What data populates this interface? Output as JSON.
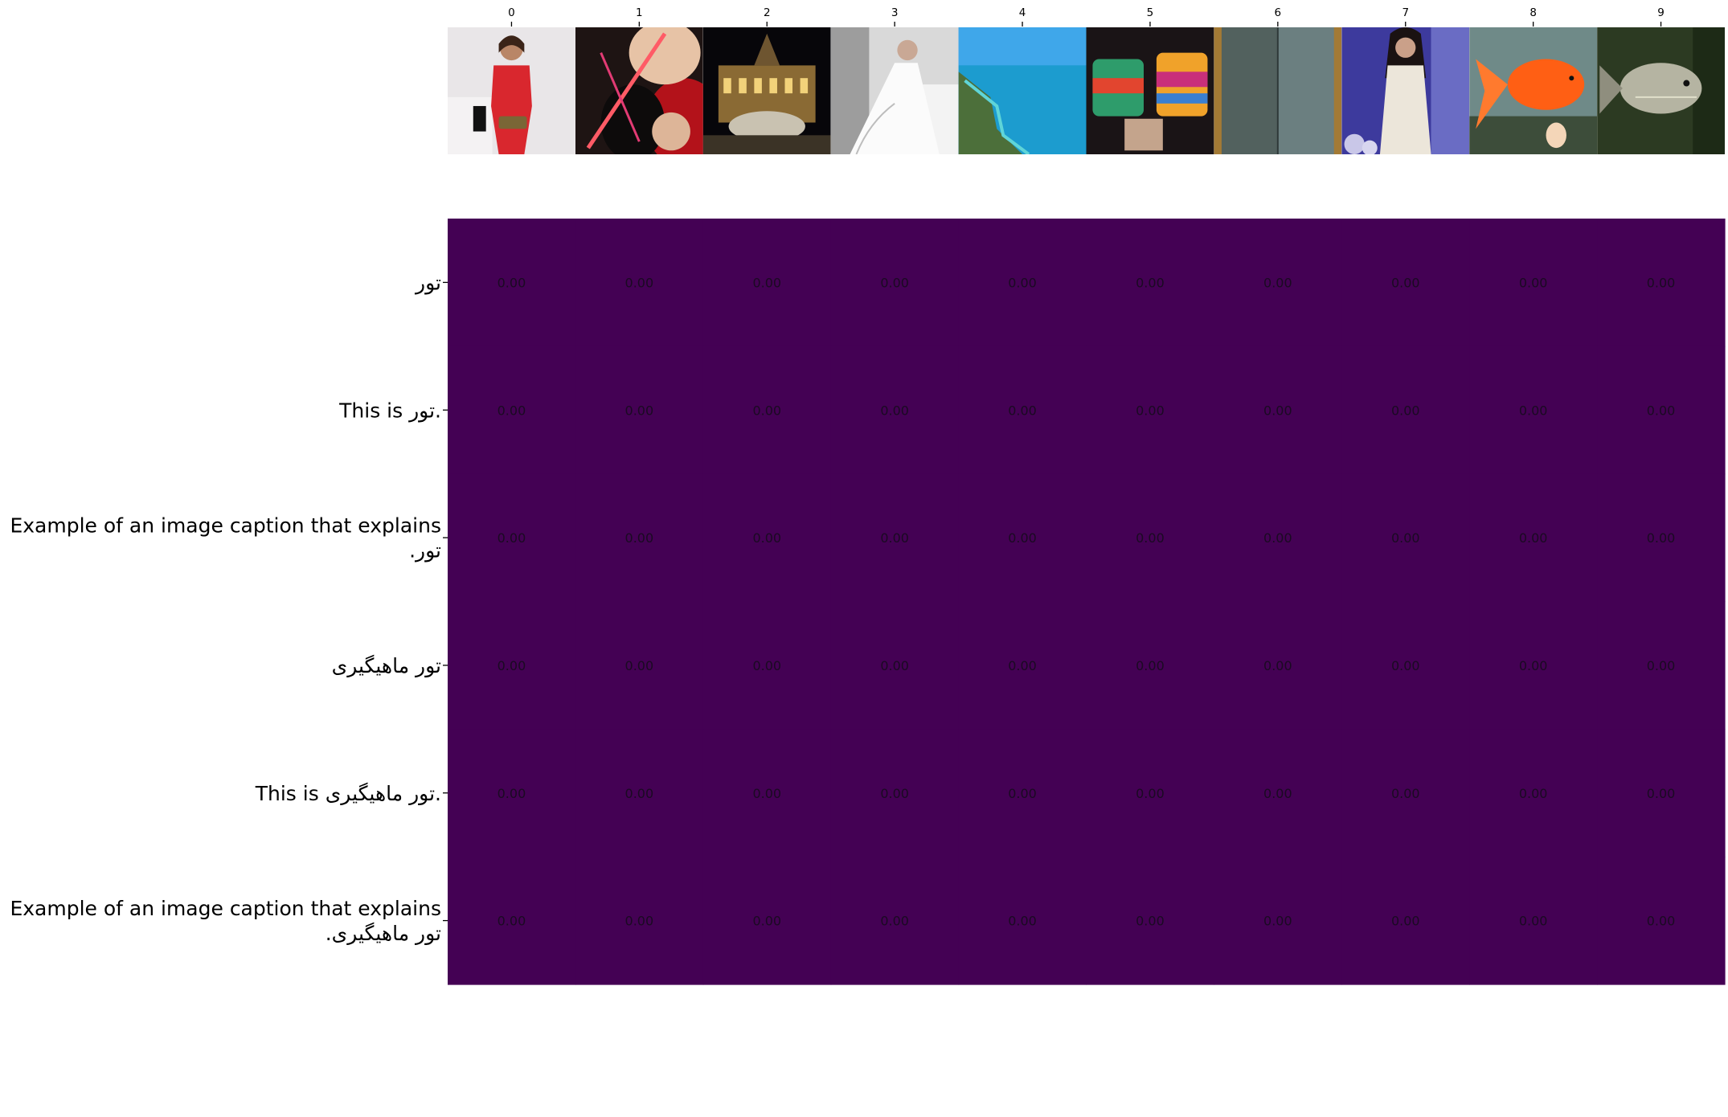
{
  "chart_data": {
    "type": "heatmap",
    "x_tick_labels": [
      "0",
      "1",
      "2",
      "3",
      "4",
      "5",
      "6",
      "7",
      "8",
      "9"
    ],
    "x_images": [
      "woman-red-dress-photo",
      "knitting-hands-red-yarn-photo",
      "illuminated-building-fountain-night-photo",
      "bride-white-wedding-dress-photo",
      "turquoise-sea-coastline-photo",
      "colorful-knitted-fingerless-gloves-photo",
      "green-mesh-screen-panel-photo",
      "woman-white-lace-outfit-photo",
      "goldfish-aquarium-photo",
      "silver-fish-aquarium-photo"
    ],
    "y_tick_labels": [
      [
        "تور"
      ],
      [
        "This is تور."
      ],
      [
        "Example of an image caption that explains",
        "تور."
      ],
      [
        "تور ماهیگیری"
      ],
      [
        "This is تور ماهیگیری."
      ],
      [
        "Example of an image caption that explains",
        "تور ماهیگیری."
      ]
    ],
    "values": [
      [
        0,
        0,
        0,
        0,
        0,
        0,
        0,
        0,
        0,
        0
      ],
      [
        0,
        0,
        0,
        0,
        0,
        0,
        0,
        0,
        0,
        0
      ],
      [
        0,
        0,
        0,
        0,
        0,
        0,
        0,
        0,
        0,
        0
      ],
      [
        0,
        0,
        0,
        0,
        0,
        0,
        0,
        0,
        0,
        0
      ],
      [
        0,
        0,
        0,
        0,
        0,
        0,
        0,
        0,
        0,
        0
      ],
      [
        0,
        0,
        0,
        0,
        0,
        0,
        0,
        0,
        0,
        0
      ]
    ],
    "cell_text": [
      [
        "0.00",
        "0.00",
        "0.00",
        "0.00",
        "0.00",
        "0.00",
        "0.00",
        "0.00",
        "0.00",
        "0.00"
      ],
      [
        "0.00",
        "0.00",
        "0.00",
        "0.00",
        "0.00",
        "0.00",
        "0.00",
        "0.00",
        "0.00",
        "0.00"
      ],
      [
        "0.00",
        "0.00",
        "0.00",
        "0.00",
        "0.00",
        "0.00",
        "0.00",
        "0.00",
        "0.00",
        "0.00"
      ],
      [
        "0.00",
        "0.00",
        "0.00",
        "0.00",
        "0.00",
        "0.00",
        "0.00",
        "0.00",
        "0.00",
        "0.00"
      ],
      [
        "0.00",
        "0.00",
        "0.00",
        "0.00",
        "0.00",
        "0.00",
        "0.00",
        "0.00",
        "0.00",
        "0.00"
      ],
      [
        "0.00",
        "0.00",
        "0.00",
        "0.00",
        "0.00",
        "0.00",
        "0.00",
        "0.00",
        "0.00",
        "0.00"
      ]
    ],
    "colormap": "viridis",
    "cell_color": "#440154",
    "grid": false,
    "legend": "none",
    "x_axis_position": "top"
  }
}
